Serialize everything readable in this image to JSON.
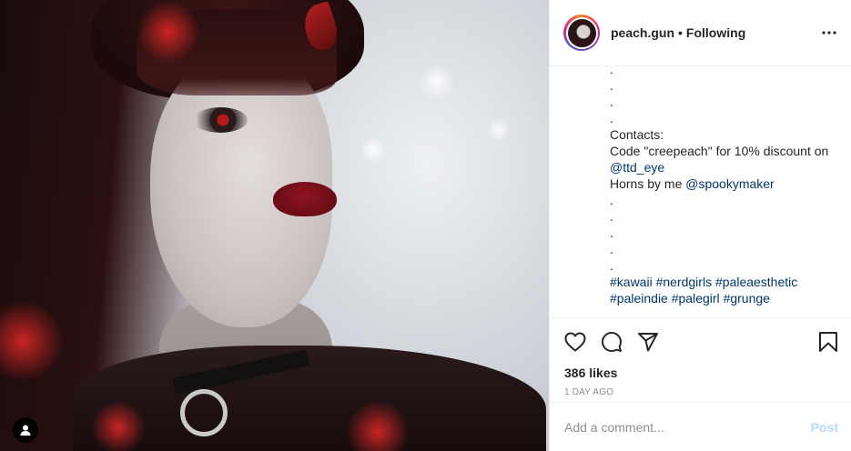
{
  "header": {
    "username": "peach.gun",
    "separator": "•",
    "follow_state": "Following",
    "avatar_icon": "profile-avatar",
    "more_icon": "more-horizontal-icon"
  },
  "caption": {
    "dots_top": [
      ".",
      ".",
      ".",
      "."
    ],
    "contacts_label": "Contacts:",
    "code_line": "Code \"creepeach\" for 10% discount on",
    "ttd_mention": "@ttd_eye",
    "ttd_suffix": " ",
    "horns_prefix": "Horns by me ",
    "horns_mention": "@spookymaker",
    "dots_bottom": [
      ".",
      ".",
      ".",
      ".",
      "."
    ],
    "hashtags_line1": [
      "#kawaii",
      "#nerdgirls",
      "#paleaesthetic"
    ],
    "hashtags_line2": [
      "#paleindie",
      "#palegirl",
      "#grunge"
    ]
  },
  "actions": {
    "like_icon": "heart-icon",
    "comment_icon": "comment-icon",
    "share_icon": "share-icon",
    "save_icon": "bookmark-icon"
  },
  "stats": {
    "likes": "386 likes",
    "timestamp": "1 DAY AGO"
  },
  "comment": {
    "placeholder": "Add a comment...",
    "post_label": "Post"
  },
  "colors": {
    "link": "#00376b",
    "post_disabled": "#b3dbff",
    "meta": "#8e8e8e",
    "border": "#efefef"
  }
}
